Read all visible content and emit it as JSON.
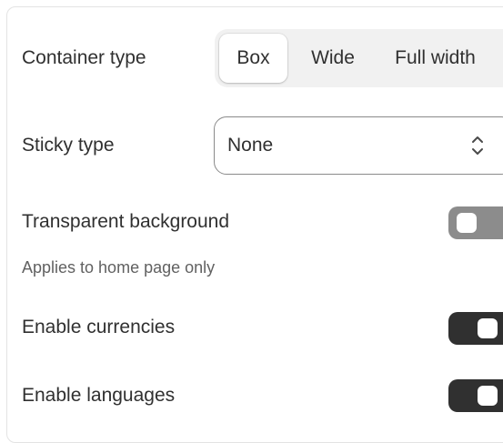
{
  "container_type": {
    "label": "Container type",
    "options": [
      "Box",
      "Wide",
      "Full width"
    ],
    "selected": "Box"
  },
  "sticky_type": {
    "label": "Sticky type",
    "value": "None",
    "icon": "select-chevrons-icon"
  },
  "transparent_background": {
    "label": "Transparent background",
    "help": "Applies to home page only",
    "enabled": false
  },
  "enable_currencies": {
    "label": "Enable currencies",
    "enabled": true
  },
  "enable_languages": {
    "label": "Enable languages",
    "enabled": true
  },
  "colors": {
    "text": "#303030",
    "muted": "#616161",
    "toggle_on": "#303030",
    "toggle_off": "#8c8c8c",
    "segment_bg": "#f1f1f1"
  }
}
